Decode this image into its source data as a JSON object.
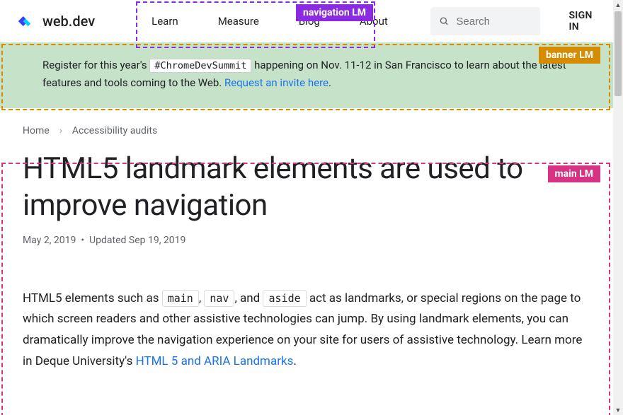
{
  "header": {
    "logo_text": "web.dev",
    "nav": [
      "Learn",
      "Measure",
      "Blog",
      "About"
    ],
    "search_placeholder": "Search",
    "signin": "SIGN IN"
  },
  "banner": {
    "text_before": "Register for this year's ",
    "hashtag": "#ChromeDevSummit",
    "text_mid": " happening on Nov. 11-12 in San Francisco to learn about the latest features and tools coming to the Web. ",
    "link_text": "Request an invite here",
    "text_after": "."
  },
  "breadcrumb": {
    "items": [
      "Home",
      "Accessibility audits"
    ]
  },
  "article": {
    "title": "HTML5 landmark elements are used to improve navigation",
    "date_published": "May 2, 2019",
    "date_updated_label": "Updated",
    "date_updated": "Sep 19, 2019",
    "para1_a": "HTML5 elements such as ",
    "code1": "main",
    "para1_b": ", ",
    "code2": "nav",
    "para1_c": ", and ",
    "code3": "aside",
    "para1_d": " act as landmarks, or special regions on the page to which screen readers and other assistive technologies can jump. By using landmark elements, you can dramatically improve the navigation experience on your site for users of assistive technology. Learn more in Deque University's ",
    "link1": "HTML 5 and ARIA Landmarks",
    "para1_e": "."
  },
  "landmarks": {
    "nav": "navigation LM",
    "banner": "banner LM",
    "main": "main LM"
  },
  "colors": {
    "accent_blue": "#1a73e8",
    "banner_bg": "#c6e3c9",
    "lm_nav": "#8a2be2",
    "lm_banner": "#d68c00",
    "lm_main": "#d63384"
  }
}
